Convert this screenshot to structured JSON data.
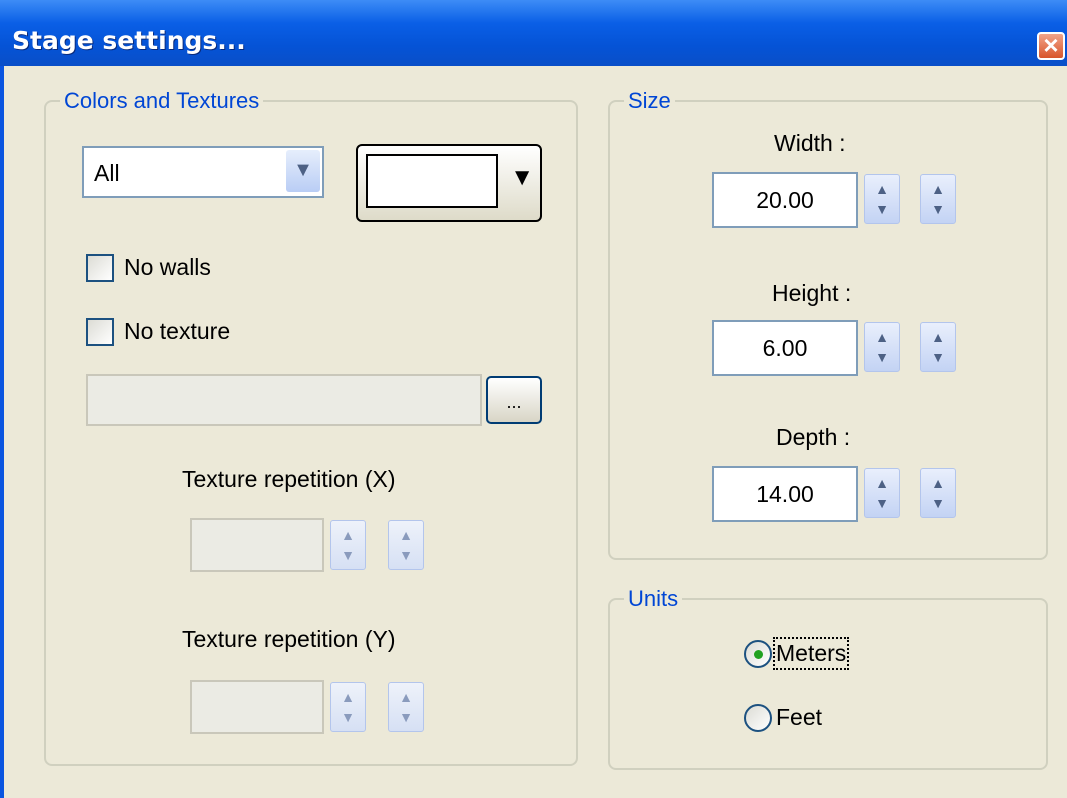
{
  "window": {
    "title": "Stage settings...",
    "close_icon": "close-icon"
  },
  "colors_textures": {
    "legend": "Colors and Textures",
    "surface_select": {
      "value": "All",
      "icon": "chevron-down-icon"
    },
    "color_button": {
      "swatch_color": "#ffffff",
      "icon": "caret-down-icon"
    },
    "no_walls_label": "No walls",
    "no_walls_checked": false,
    "no_texture_label": "No texture",
    "no_texture_checked": false,
    "texture_path": "",
    "browse_label": "...",
    "repeat_x_label": "Texture repetition (X)",
    "repeat_x_value": "",
    "repeat_y_label": "Texture repetition (Y)",
    "repeat_y_value": ""
  },
  "size": {
    "legend": "Size",
    "width_label": "Width :",
    "width_value": "20.00",
    "height_label": "Height :",
    "height_value": "6.00",
    "depth_label": "Depth :",
    "depth_value": "14.00"
  },
  "units": {
    "legend": "Units",
    "options": [
      {
        "label": "Meters",
        "selected": true
      },
      {
        "label": "Feet",
        "selected": false
      }
    ]
  },
  "colors": {
    "title_bar": "#0553d6",
    "legend_text": "#0046d5",
    "dialog_bg": "#ece9d8",
    "radio_dot": "#21a121"
  }
}
